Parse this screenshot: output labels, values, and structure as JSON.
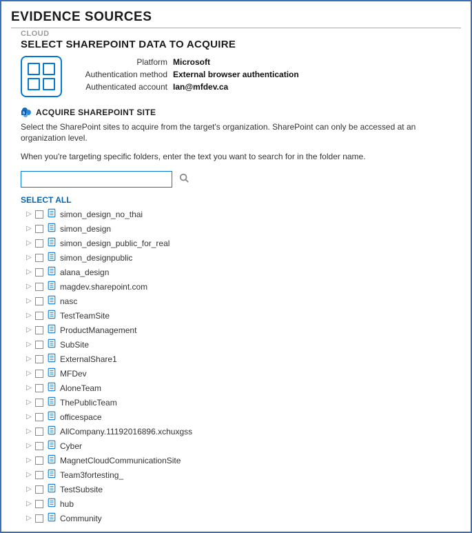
{
  "header": {
    "title": "EVIDENCE SOURCES",
    "cloud_label": "CLOUD",
    "section_title": "SELECT SHAREPOINT DATA TO ACQUIRE"
  },
  "info": {
    "platform_label": "Platform",
    "platform_value": "Microsoft",
    "auth_method_label": "Authentication method",
    "auth_method_value": "External browser authentication",
    "auth_account_label": "Authenticated account",
    "auth_account_value": "Ian@mfdev.ca"
  },
  "acquire": {
    "header": "ACQUIRE SHAREPOINT SITE",
    "desc1": "Select the SharePoint sites to acquire from the target's organization. SharePoint can only be accessed at an organization level.",
    "desc2": "When you're targeting specific folders, enter the text you want to search for in the folder name."
  },
  "search": {
    "value": "",
    "placeholder": ""
  },
  "select_all": "SELECT ALL",
  "sites": [
    {
      "label": "simon_design_no_thai"
    },
    {
      "label": "simon_design"
    },
    {
      "label": "simon_design_public_for_real"
    },
    {
      "label": "simon_designpublic"
    },
    {
      "label": "alana_design"
    },
    {
      "label": "magdev.sharepoint.com"
    },
    {
      "label": "nasc"
    },
    {
      "label": "TestTeamSite"
    },
    {
      "label": "ProductManagement"
    },
    {
      "label": "SubSite"
    },
    {
      "label": "ExternalShare1"
    },
    {
      "label": "MFDev"
    },
    {
      "label": "AloneTeam"
    },
    {
      "label": "ThePublicTeam"
    },
    {
      "label": "officespace"
    },
    {
      "label": "AllCompany.11192016896.xchuxgss"
    },
    {
      "label": "Cyber"
    },
    {
      "label": "MagnetCloudCommunicationSite"
    },
    {
      "label": "Team3fortesting_"
    },
    {
      "label": "TestSubsite"
    },
    {
      "label": "hub"
    },
    {
      "label": "Community"
    }
  ]
}
